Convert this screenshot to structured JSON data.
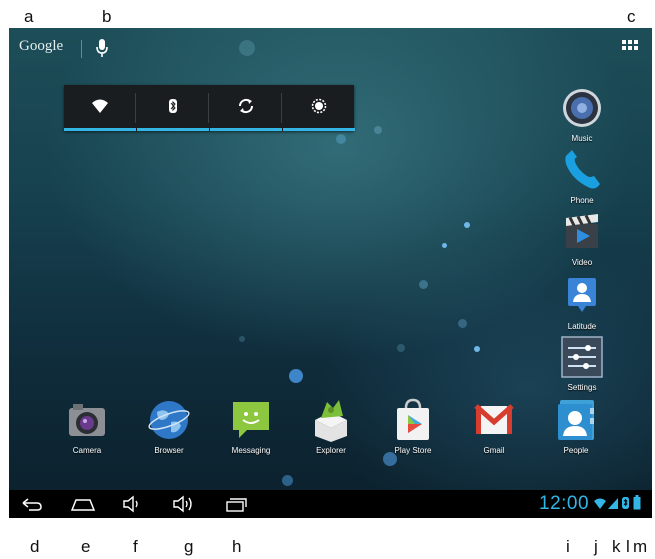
{
  "callouts": {
    "a": "a",
    "b": "b",
    "c": "c",
    "d": "d",
    "e": "e",
    "f": "f",
    "g": "g",
    "h": "h",
    "i": "i",
    "j": "j",
    "k": "k",
    "l": "l",
    "m": "m"
  },
  "search_bar": {
    "logo_text": "Google",
    "mic_icon": "mic-icon",
    "apps_icon": "all-apps-icon"
  },
  "power_widget": {
    "buttons": [
      "wifi-icon",
      "bluetooth-icon",
      "sync-icon",
      "brightness-icon"
    ],
    "accent": "#33b5e5"
  },
  "right_apps": [
    {
      "label": "Music",
      "icon": "music-icon"
    },
    {
      "label": "Phone",
      "icon": "phone-icon"
    },
    {
      "label": "Video",
      "icon": "video-icon"
    },
    {
      "label": "Latitude",
      "icon": "latitude-icon"
    },
    {
      "label": "Settings",
      "icon": "settings-icon"
    }
  ],
  "dock_apps": [
    {
      "label": "Camera",
      "icon": "camera-icon"
    },
    {
      "label": "Browser",
      "icon": "browser-icon"
    },
    {
      "label": "Messaging",
      "icon": "messaging-icon"
    },
    {
      "label": "Explorer",
      "icon": "explorer-icon"
    },
    {
      "label": "Play Store",
      "icon": "play-store-icon"
    },
    {
      "label": "Gmail",
      "icon": "gmail-icon"
    },
    {
      "label": "People",
      "icon": "people-icon"
    }
  ],
  "navbar": {
    "buttons": [
      "back-icon",
      "home-icon",
      "volume-down-icon",
      "volume-up-icon",
      "recent-apps-icon"
    ],
    "clock": "12:00",
    "status_icons": [
      "wifi-signal-icon",
      "cell-signal-icon",
      "bluetooth-status-icon",
      "battery-icon"
    ]
  }
}
